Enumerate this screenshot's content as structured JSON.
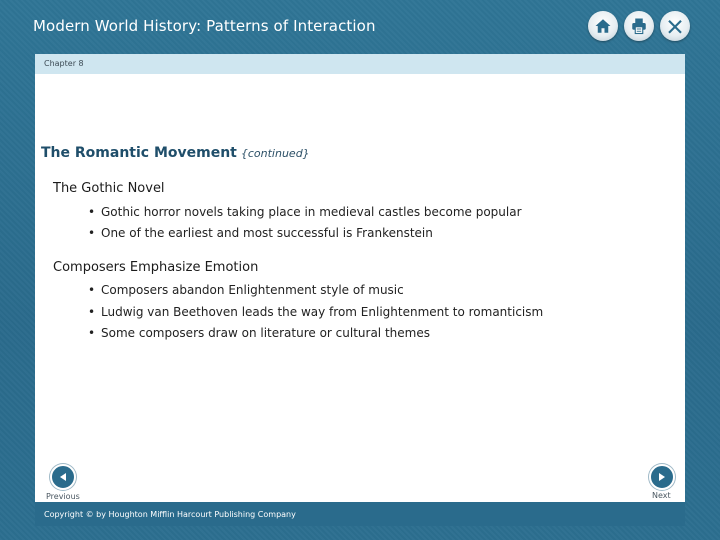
{
  "header": {
    "title": "Modern World History: Patterns of Interaction",
    "icons": [
      "home-icon",
      "print-icon",
      "close-icon"
    ]
  },
  "chapter": {
    "label": "Chapter 8"
  },
  "slide": {
    "title": "The Romantic Movement",
    "subtitle": "{continued}",
    "sections": [
      {
        "heading": "The Gothic Novel",
        "bullets": [
          "Gothic horror novels taking place in medieval castles become popular",
          "One of the earliest and most successful is Frankenstein"
        ]
      },
      {
        "heading": "Composers Emphasize Emotion",
        "bullets": [
          "Composers abandon Enlightenment style of music",
          "Ludwig van Beethoven leads the way from Enlightenment to romanticism",
          "Some composers draw on literature or cultural themes"
        ]
      }
    ]
  },
  "nav": {
    "previous_label": "Previous",
    "next_label": "Next"
  },
  "footer": {
    "copyright": "Copyright © by Houghton Mifflin Harcourt Publishing Company"
  },
  "colors": {
    "frame": "#2c6f90",
    "chapter_bar": "#cfe6f0",
    "title": "#1f4e6a"
  }
}
